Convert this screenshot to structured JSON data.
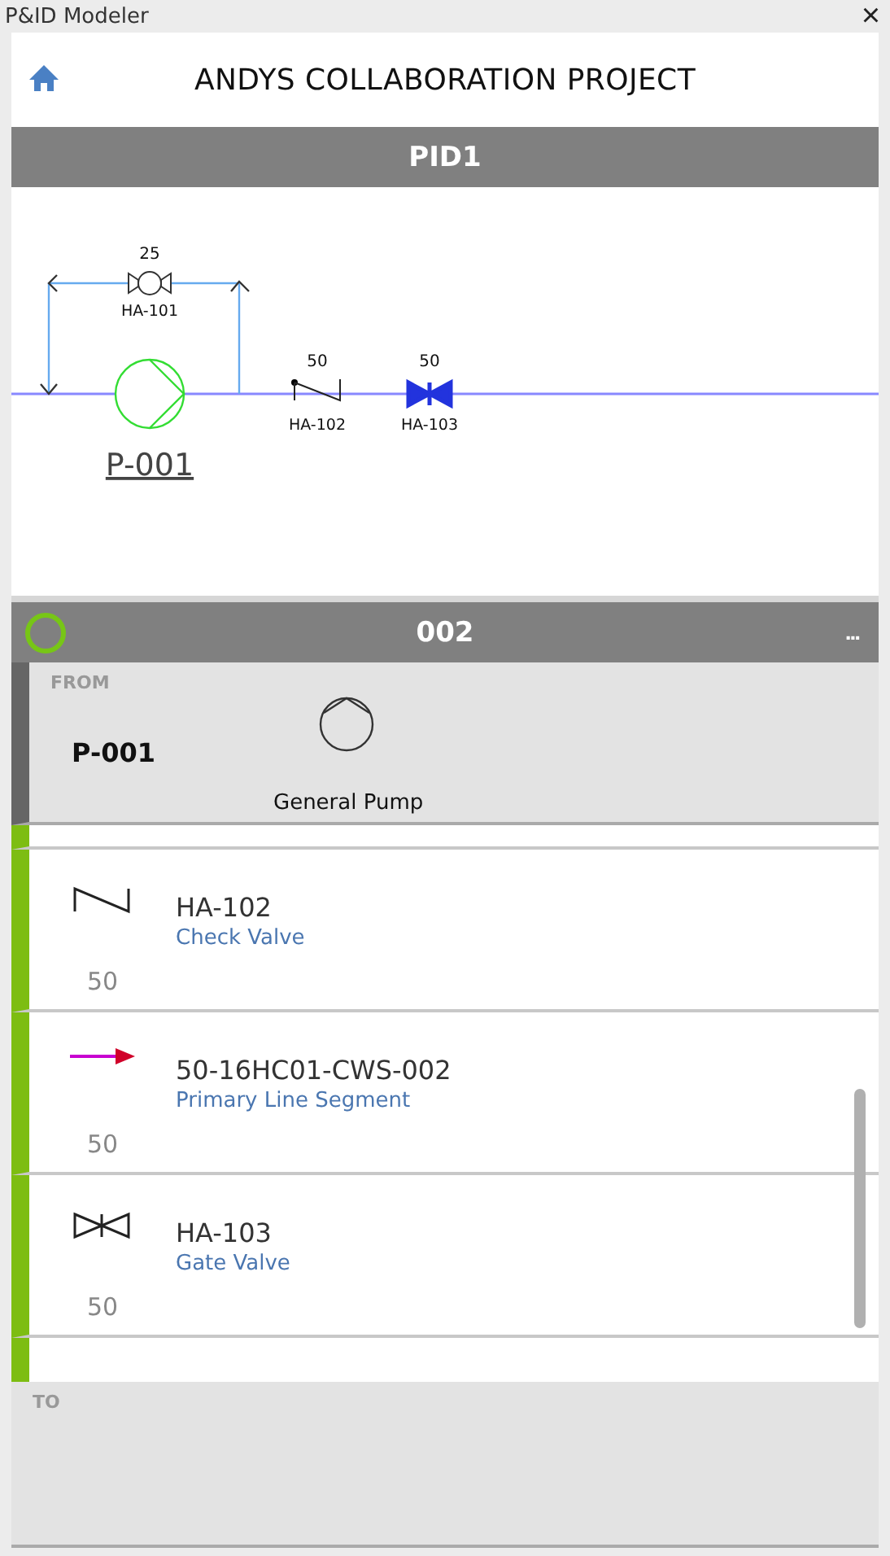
{
  "window": {
    "title": "P&ID Modeler",
    "close": "×"
  },
  "header": {
    "title": "ANDYS COLLABORATION PROJECT"
  },
  "drawing_bar": {
    "title": "PID1"
  },
  "diagram": {
    "bypass_valve": {
      "size": "25",
      "tag": "HA-101"
    },
    "pump": {
      "tag": "P-001"
    },
    "valves": [
      {
        "kind": "check",
        "size": "50",
        "tag": "HA-102"
      },
      {
        "kind": "gate",
        "size": "50",
        "tag": "HA-103"
      }
    ]
  },
  "line_bar": {
    "title": "002",
    "menu": "..."
  },
  "from": {
    "label": "FROM",
    "tag": "P-001",
    "type": "General Pump"
  },
  "items": [
    {
      "kind": "check",
      "tag": "HA-102",
      "type": "Check Valve",
      "size": "50"
    },
    {
      "kind": "segment",
      "tag": "50-16HC01-CWS-002",
      "type": "Primary Line Segment",
      "size": "50"
    },
    {
      "kind": "gate",
      "tag": "HA-103",
      "type": "Gate Valve",
      "size": "50"
    }
  ],
  "to": {
    "label": "TO"
  }
}
